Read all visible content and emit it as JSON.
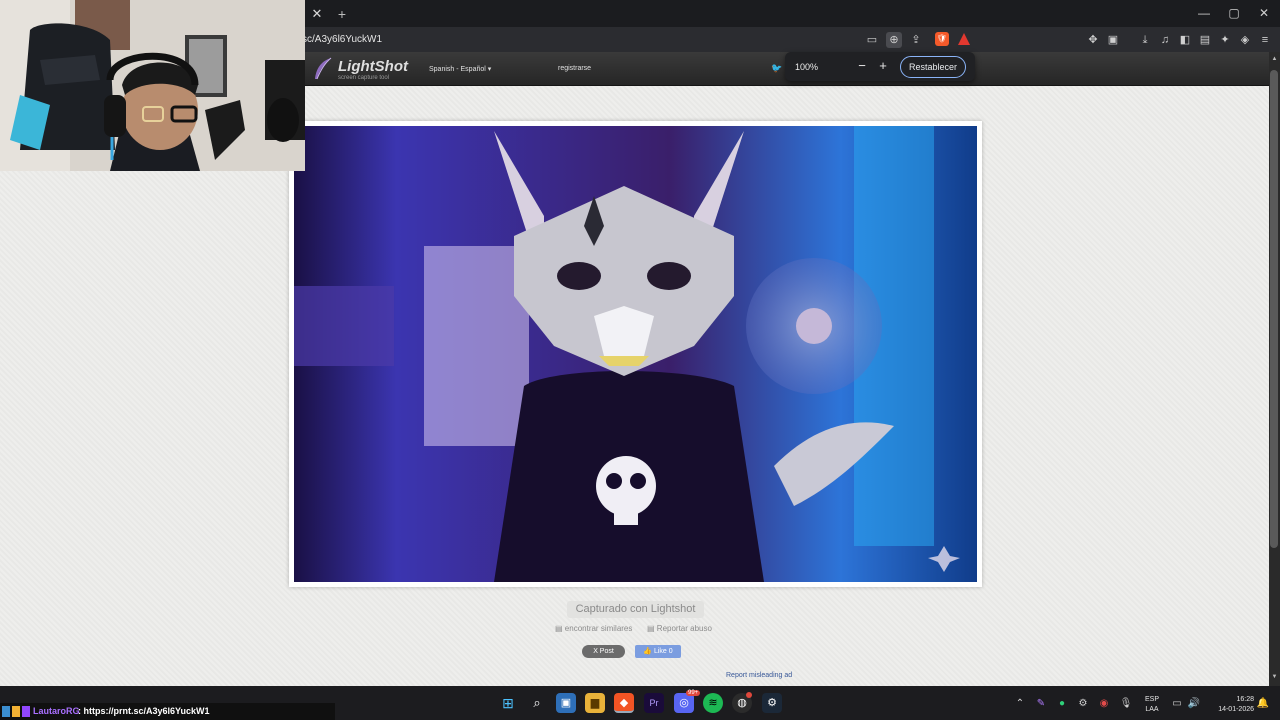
{
  "browser": {
    "url": "sc/A3y6l6YuckW1",
    "tab_close": "✕",
    "new_tab": "+",
    "window_buttons": [
      "—",
      "▢",
      "✕"
    ]
  },
  "zoom_popup": {
    "level": "100%",
    "minus": "−",
    "plus": "+",
    "reset_label": "Restablecer"
  },
  "lightshot": {
    "logo": "LightShot",
    "tagline": "screen capture tool",
    "language": "Spanish - Español",
    "register": "registrarse",
    "captured_label": "Capturado con Lightshot",
    "find_similar": "encontrar similares",
    "report_abuse": "Reportar abuso",
    "post_button": "X Post",
    "like_button": "Like 0",
    "report_ad": "Report misleading ad"
  },
  "chat": {
    "user": "LautaroRG",
    "message": ": https://prnt.sc/A3y6l6YuckW1"
  },
  "taskbar": {
    "language_line1": "ESP",
    "language_line2": "LAA",
    "time": "16:28",
    "date": "14-01-2026",
    "discord_badge": "99+"
  },
  "colors": {
    "chat_user": "#a970ff",
    "reset_border": "#8ab4f8",
    "brave_orange": "#f45a2a"
  }
}
